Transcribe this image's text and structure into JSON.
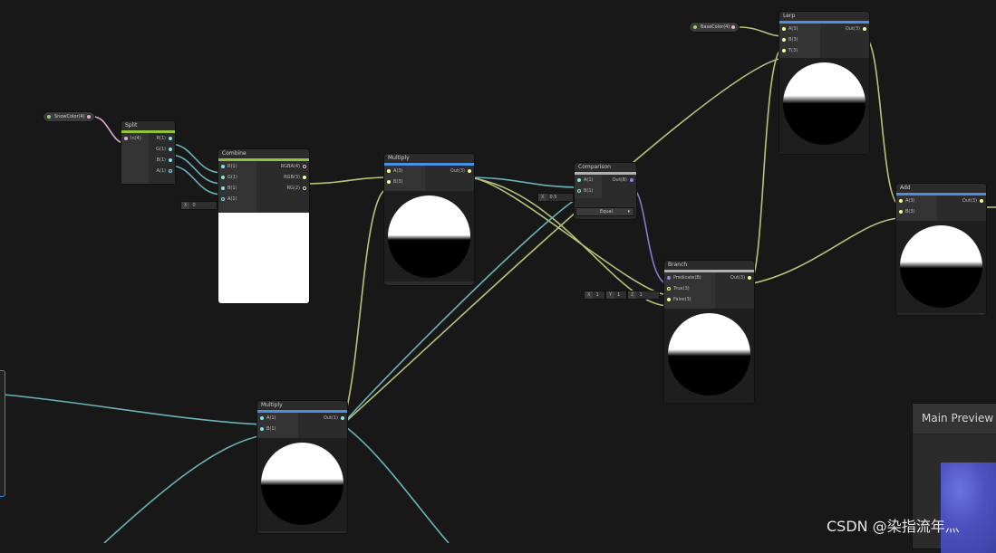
{
  "properties": {
    "snow_color": "SnowColor(4)",
    "base_color": "BaseColor(4)"
  },
  "nodes": {
    "split": {
      "title": "Split",
      "inputs": [
        "In(4)"
      ],
      "outputs": [
        "R(1)",
        "G(1)",
        "B(1)",
        "A(1)"
      ]
    },
    "combine": {
      "title": "Combine",
      "inputs": [
        "R(1)",
        "G(1)",
        "B(1)",
        "A(1)"
      ],
      "outputs": [
        "RGBA(4)",
        "RGB(3)",
        "RG(2)"
      ],
      "a_field_label": "X",
      "a_field_value": "0"
    },
    "multiply_top": {
      "title": "Multiply",
      "inputs": [
        "A(3)",
        "B(3)"
      ],
      "outputs": [
        "Out(3)"
      ]
    },
    "comparison": {
      "title": "Comparison",
      "inputs": [
        "A(1)",
        "B(1)"
      ],
      "outputs": [
        "Out(B)"
      ],
      "b_field_label": "X",
      "b_field_value": "0.5",
      "mode": "Equal"
    },
    "branch": {
      "title": "Branch",
      "inputs": [
        "Predicate(B)",
        "True(3)",
        "False(3)"
      ],
      "outputs": [
        "Out(3)"
      ],
      "false_x_label": "X",
      "false_x": "1",
      "false_y_label": "Y",
      "false_y": "1",
      "false_z_label": "Z",
      "false_z": "1"
    },
    "lerp": {
      "title": "Lerp",
      "inputs": [
        "A(3)",
        "B(3)",
        "T(3)"
      ],
      "outputs": [
        "Out(3)"
      ]
    },
    "add": {
      "title": "Add",
      "inputs": [
        "A(3)",
        "B(3)"
      ],
      "outputs": [
        "Out(3)"
      ]
    },
    "multiply_bottom": {
      "title": "Multiply",
      "inputs": [
        "A(1)",
        "B(1)"
      ],
      "outputs": [
        "Out(1)"
      ]
    }
  },
  "main_preview": {
    "title": "Main Preview"
  },
  "watermark": "CSDN @染指流年灬",
  "colors": {
    "background": "#181818",
    "vector3_wire": "#b8c27a",
    "vector1_wire": "#6ab3b8",
    "bool_wire": "#8a7ad0",
    "vector4_port": "#e0b0d8",
    "vector1_port": "#84e4e7",
    "vector3_port": "#f6ff9a",
    "bool_port": "#9481e6",
    "header_blue": "#4a90e2",
    "header_green": "#8fc43a",
    "header_gray": "#b0b0b0"
  }
}
